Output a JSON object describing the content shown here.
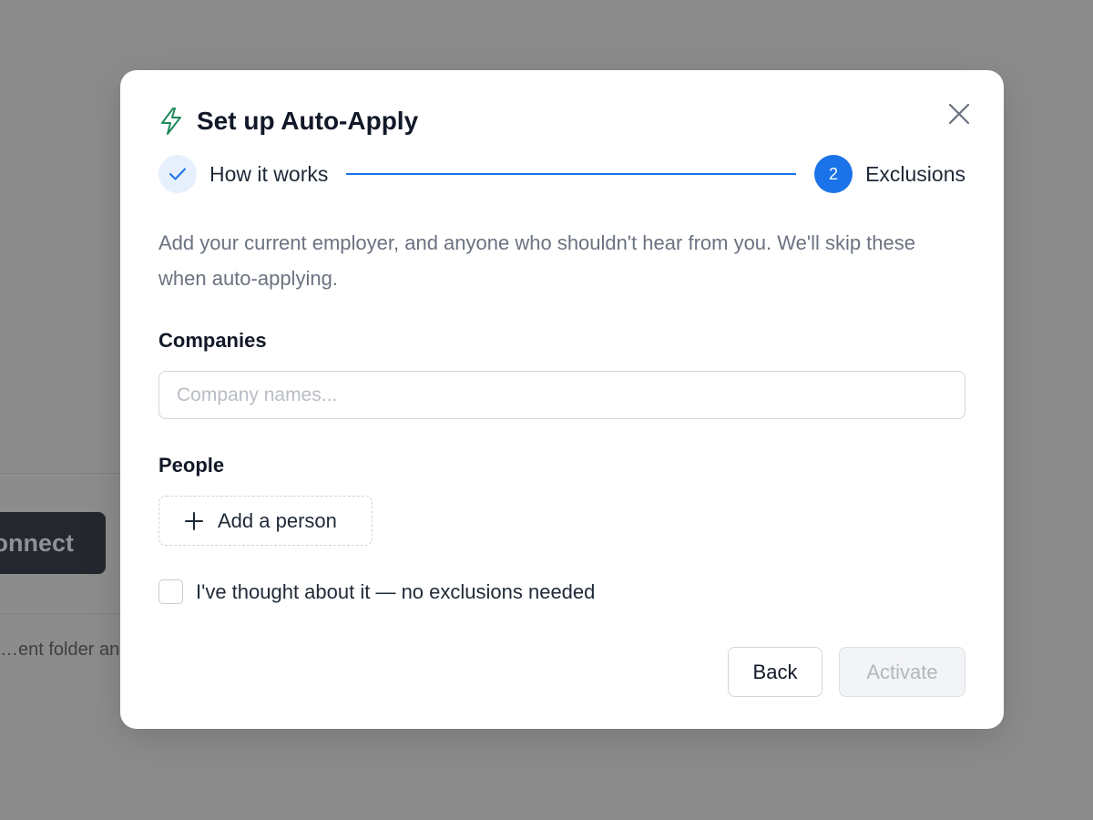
{
  "background": {
    "connect_label": "Connect",
    "snippet_text": "…ent folder and…"
  },
  "modal": {
    "title": "Set up Auto-Apply",
    "title_icon": "lightning-bolt-icon",
    "close_icon": "close-icon",
    "stepper": {
      "steps": [
        {
          "label": "How it works",
          "state": "completed",
          "icon": "checkmark-icon"
        },
        {
          "label": "Exclusions",
          "state": "active",
          "number": "2"
        }
      ],
      "accent_color": "#1a73e8"
    },
    "description": "Add your current employer, and anyone who shouldn't hear from you. We'll skip these when auto-applying.",
    "companies": {
      "label": "Companies",
      "placeholder": "Company names...",
      "value": ""
    },
    "people": {
      "label": "People",
      "add_button_label": "Add a person",
      "add_icon": "plus-icon"
    },
    "no_exclusions": {
      "label": "I've thought about it — no exclusions needed",
      "checked": false
    },
    "footer": {
      "back_label": "Back",
      "activate_label": "Activate",
      "activate_disabled": true
    }
  }
}
